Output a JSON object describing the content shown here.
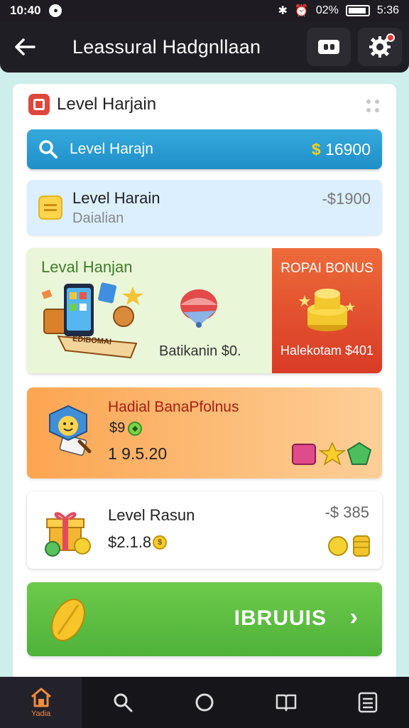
{
  "status_bar": {
    "time": "10:40",
    "battery_text": "02%",
    "clock_right": "5:36"
  },
  "app_bar": {
    "title": "Leassural Hadgnllaan"
  },
  "sheet": {
    "title": "Level Harjain"
  },
  "search_row": {
    "label": "Level Harajn",
    "currency": "$",
    "amount": "16900"
  },
  "info_row": {
    "title": "Level Harain",
    "subtitle": "Daialian",
    "amount": "-$1900"
  },
  "promo": {
    "title": "Leval Hanjan",
    "ribbon_text": "EDIBOMAI",
    "note": "Batikanin $0.",
    "bonus_title": "ROPAI BONUS",
    "bonus_note": "Halekotam $401"
  },
  "offer": {
    "title": "Hadial BanaPfolnus",
    "code": "$9",
    "value": "1 9.5.20"
  },
  "level_row": {
    "title": "Level Rasun",
    "value": "$2.1.8",
    "amount": "-$ 385"
  },
  "cta": {
    "label": "IBRUUIS"
  },
  "bottom_nav": {
    "home_label": "Yadia"
  },
  "colors": {
    "app_bar": "#1f1e24",
    "search_blue": "#2a9dd2",
    "promo_green": "#eaf6d8",
    "bonus_red": "#e1472d",
    "offer_orange": "#fca551",
    "cta_green": "#5cbb40",
    "nav_accent": "#f08a3c"
  }
}
